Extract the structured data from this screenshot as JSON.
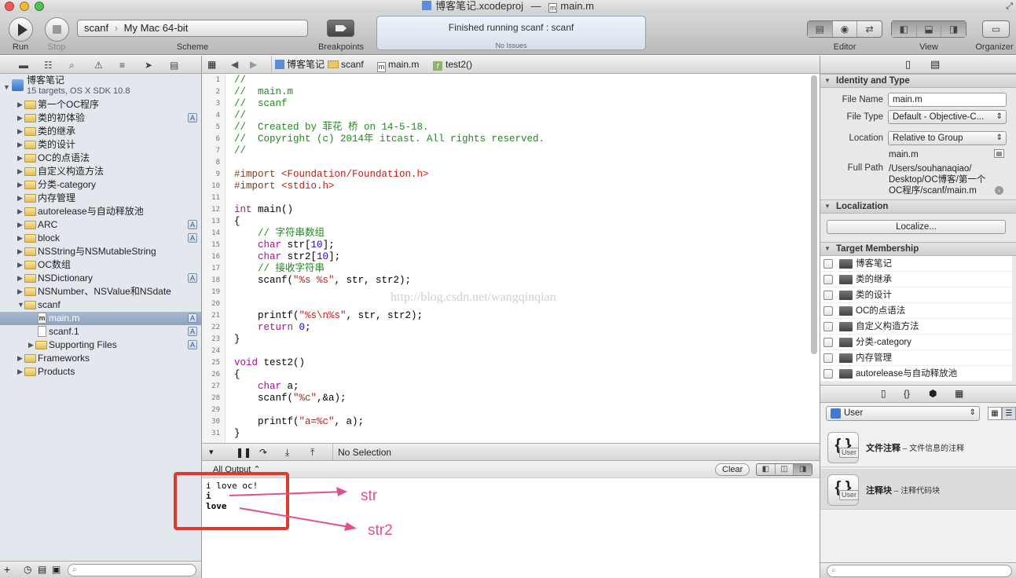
{
  "window": {
    "title": "博客笔记.xcodeproj",
    "separator": "—",
    "file": "main.m"
  },
  "toolbar": {
    "run_label": "Run",
    "stop_label": "Stop",
    "scheme_target": "scanf",
    "scheme_dest": "My Mac 64-bit",
    "scheme_label": "Scheme",
    "breakpoints_label": "Breakpoints",
    "activity_status": "Finished running scanf : scanf",
    "activity_issues": "No Issues",
    "editor_label": "Editor",
    "view_label": "View",
    "organizer_label": "Organizer"
  },
  "navigator": {
    "project_name": "博客笔记",
    "project_sub": "15 targets, OS X SDK 10.8",
    "items": [
      {
        "label": "第一个OC程序",
        "badge": ""
      },
      {
        "label": "类的初体验",
        "badge": "A"
      },
      {
        "label": "类的继承",
        "badge": ""
      },
      {
        "label": "类的设计",
        "badge": ""
      },
      {
        "label": "OC的点语法",
        "badge": ""
      },
      {
        "label": "自定义构造方法",
        "badge": ""
      },
      {
        "label": "分类-category",
        "badge": ""
      },
      {
        "label": "内存管理",
        "badge": ""
      },
      {
        "label": "autorelease与自动释放池",
        "badge": ""
      },
      {
        "label": "ARC",
        "badge": "A"
      },
      {
        "label": "block",
        "badge": "A"
      },
      {
        "label": "NSString与NSMutableString",
        "badge": ""
      },
      {
        "label": "OC数组",
        "badge": ""
      },
      {
        "label": "NSDictionary",
        "badge": "A"
      },
      {
        "label": "NSNumber、NSValue和NSdate",
        "badge": ""
      },
      {
        "label": "scanf",
        "badge": ""
      }
    ],
    "scanf_children": [
      {
        "label": "main.m",
        "badge": "A",
        "icon": "m"
      },
      {
        "label": "scanf.1",
        "badge": "A",
        "icon": ""
      },
      {
        "label": "Supporting Files",
        "badge": "A",
        "icon": "folder"
      }
    ],
    "bottom_items": [
      "Frameworks",
      "Products"
    ]
  },
  "jumpbar": {
    "project": "博客笔记",
    "group": "scanf",
    "file": "main.m",
    "func_icon": "f",
    "func": "test2()"
  },
  "editor": {
    "lines": [
      {
        "n": "1",
        "t": "//"
      },
      {
        "n": "2",
        "t": "//  main.m"
      },
      {
        "n": "3",
        "t": "//  scanf"
      },
      {
        "n": "4",
        "t": "//"
      },
      {
        "n": "5",
        "t": "//  Created by 菲花 桥 on 14-5-18."
      },
      {
        "n": "6",
        "t": "//  Copyright (c) 2014年 itcast. All rights reserved."
      },
      {
        "n": "7",
        "t": "//"
      },
      {
        "n": "8",
        "t": ""
      },
      {
        "n": "9",
        "t": "#import <Foundation/Foundation.h>"
      },
      {
        "n": "10",
        "t": "#import <stdio.h>"
      },
      {
        "n": "11",
        "t": ""
      },
      {
        "n": "12",
        "t": "int main()"
      },
      {
        "n": "13",
        "t": "{"
      },
      {
        "n": "14",
        "t": "    // 字符串数组"
      },
      {
        "n": "15",
        "t": "    char str[10];"
      },
      {
        "n": "16",
        "t": "    char str2[10];"
      },
      {
        "n": "17",
        "t": "    // 接收字符串"
      },
      {
        "n": "18",
        "t": "    scanf(\"%s %s\", str, str2);"
      },
      {
        "n": "19",
        "t": ""
      },
      {
        "n": "20",
        "t": ""
      },
      {
        "n": "21",
        "t": "    printf(\"%s\\n%s\", str, str2);"
      },
      {
        "n": "22",
        "t": "    return 0;"
      },
      {
        "n": "23",
        "t": "}"
      },
      {
        "n": "24",
        "t": ""
      },
      {
        "n": "25",
        "t": "void test2()"
      },
      {
        "n": "26",
        "t": "{"
      },
      {
        "n": "27",
        "t": "    char a;"
      },
      {
        "n": "28",
        "t": "    scanf(\"%c\",&a);"
      },
      {
        "n": "29",
        "t": ""
      },
      {
        "n": "30",
        "t": "    printf(\"a=%c\", a);"
      },
      {
        "n": "31",
        "t": "}"
      }
    ],
    "watermark": "http://blog.csdn.net/wangqinqian"
  },
  "debug": {
    "selection": "No Selection",
    "output_filter": "All Output ⌃",
    "clear_label": "Clear"
  },
  "console": {
    "lines": [
      "i love oc!",
      "i",
      "love"
    ]
  },
  "annotations": {
    "str": "str",
    "str2": "str2"
  },
  "inspector": {
    "identity_title": "Identity and Type",
    "file_name_label": "File Name",
    "file_name": "main.m",
    "file_type_label": "File Type",
    "file_type": "Default - Objective-C...",
    "location_label": "Location",
    "location": "Relative to Group",
    "location_file": "main.m",
    "full_path_label": "Full Path",
    "full_path_1": "/Users/souhanaqiao/",
    "full_path_2": "Desktop/OC博客/第一个",
    "full_path_3": "OC程序/scanf/main.m",
    "localization_title": "Localization",
    "localize_button": "Localize...",
    "membership_title": "Target Membership",
    "targets": [
      "博客笔记",
      "类的继承",
      "类的设计",
      "OC的点语法",
      "自定义构造方法",
      "分类-category",
      "内存管理",
      "autorelease与自动释放池"
    ]
  },
  "library": {
    "filter": "User",
    "snippets": [
      {
        "title": "文件注释",
        "desc": " – 文件信息的注释",
        "badge": "User"
      },
      {
        "title": "注释块",
        "desc": " – 注释代码块",
        "badge": "User"
      }
    ]
  },
  "colors": {
    "comment": "#1f8a1f",
    "preproc": "#7a3d1b",
    "string": "#c41a16",
    "keyword": "#aa0d91",
    "number": "#1c00cf",
    "highlight": "#e03a2f",
    "annotation": "#e0508f"
  }
}
